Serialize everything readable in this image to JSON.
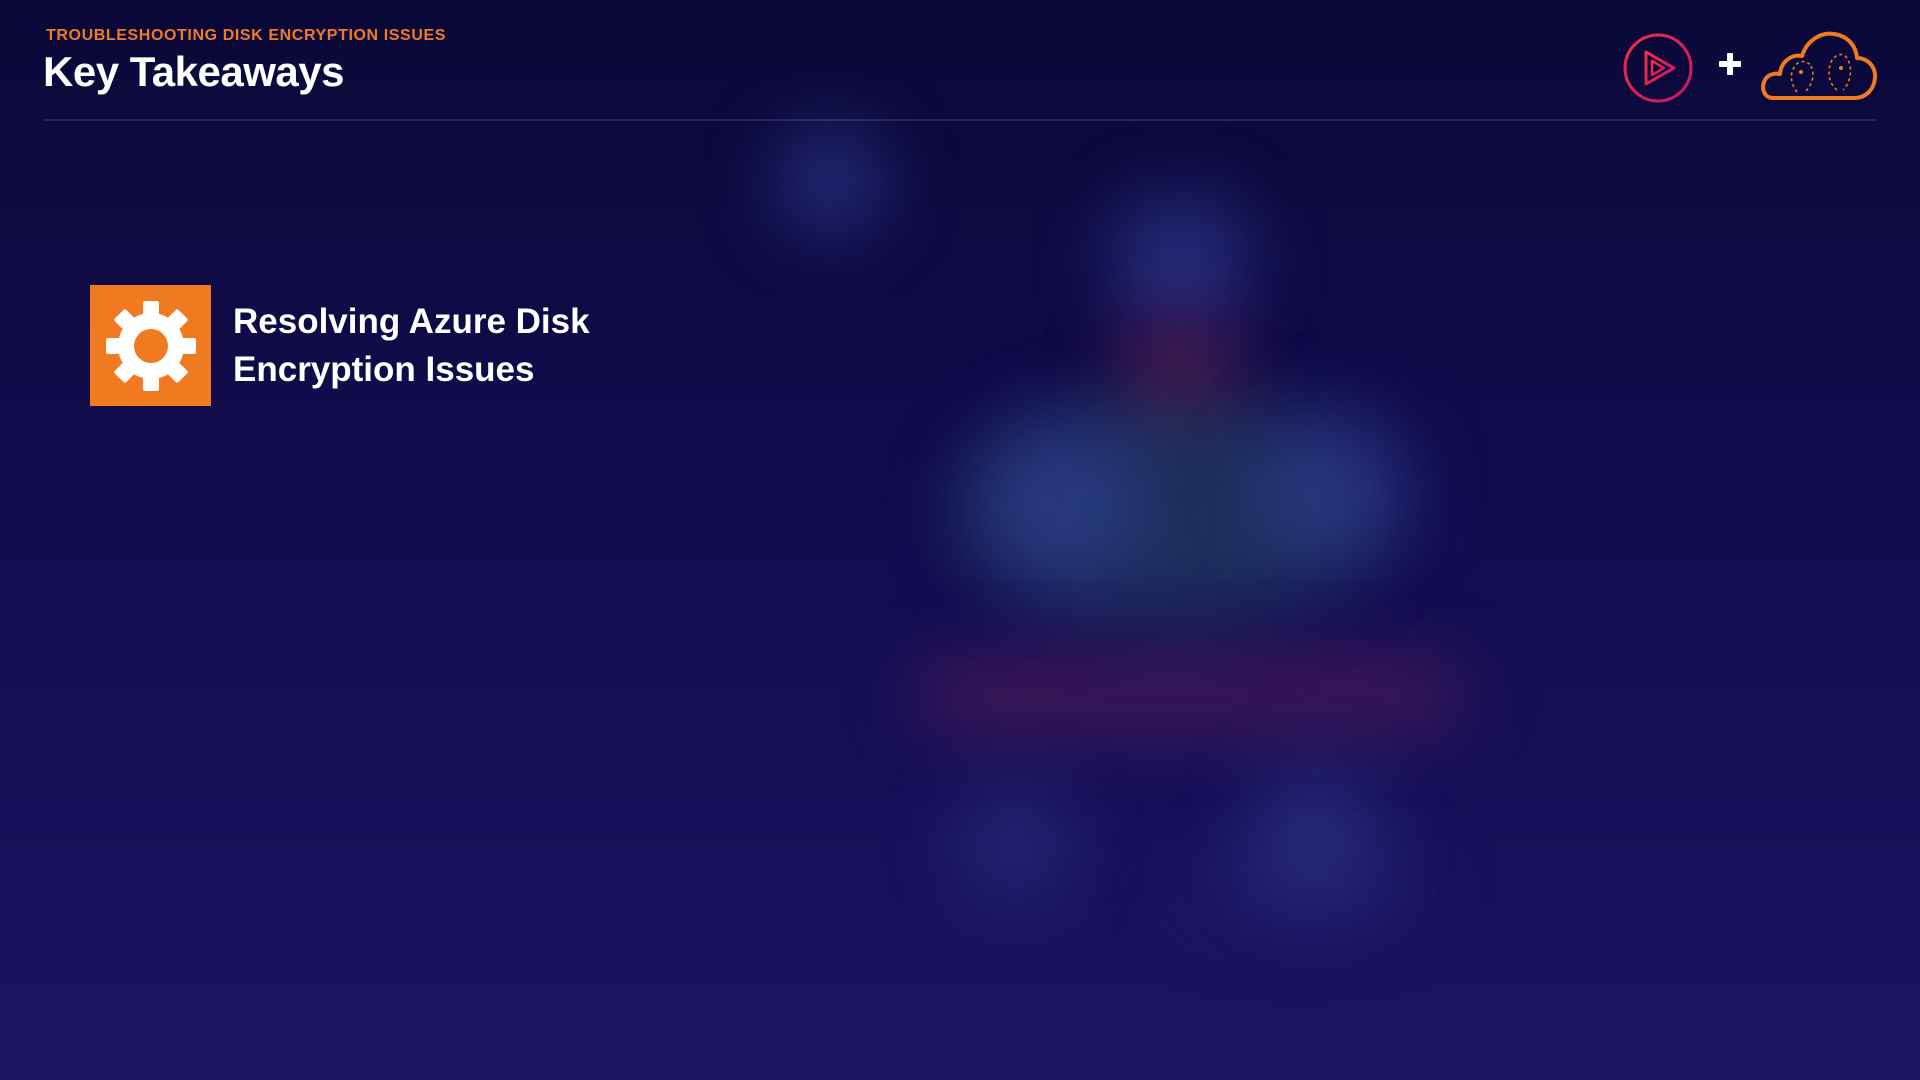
{
  "header": {
    "eyebrow": "TROUBLESHOOTING DISK ENCRYPTION ISSUES",
    "title": "Key Takeaways"
  },
  "logos": {
    "left": "play-logo-icon",
    "separator": "plus-icon",
    "right": "cloud-brain-logo-icon"
  },
  "takeaways": [
    {
      "icon": "gear-icon",
      "text": "Resolving Azure Disk Encryption Issues"
    }
  ],
  "colors": {
    "background_top": "#0a0838",
    "background_bottom": "#1b1463",
    "accent_orange": "#f07a20",
    "play_logo_pink": "#e0245e",
    "text_white": "#ffffff"
  }
}
